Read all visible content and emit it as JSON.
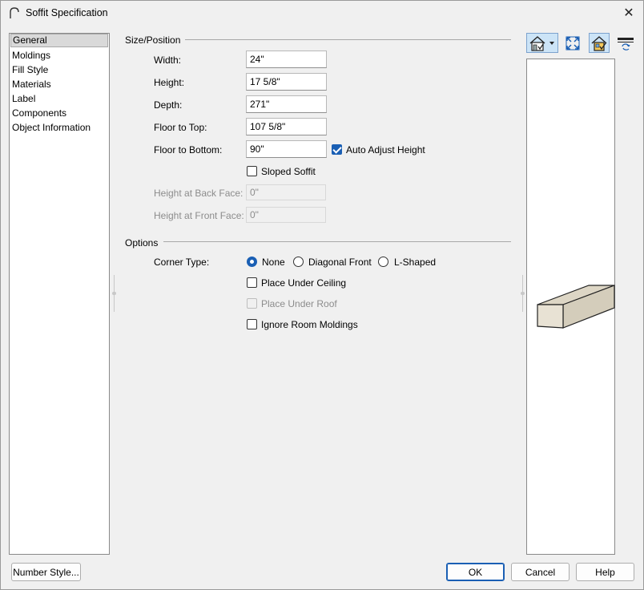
{
  "window": {
    "title": "Soffit Specification",
    "close_glyph": "✕"
  },
  "sidebar": {
    "items": [
      {
        "label": "General",
        "selected": true
      },
      {
        "label": "Moldings"
      },
      {
        "label": "Fill Style"
      },
      {
        "label": "Materials"
      },
      {
        "label": "Label"
      },
      {
        "label": "Components"
      },
      {
        "label": "Object Information"
      }
    ]
  },
  "size_position": {
    "heading": "Size/Position",
    "width": {
      "label": "Width:",
      "value": "24\""
    },
    "height": {
      "label": "Height:",
      "value": "17 5/8\""
    },
    "depth": {
      "label": "Depth:",
      "value": "271\""
    },
    "floor_to_top": {
      "label": "Floor to Top:",
      "value": "107 5/8\""
    },
    "floor_to_bottom": {
      "label": "Floor to Bottom:",
      "value": "90\""
    },
    "auto_adjust_height": {
      "label": "Auto Adjust Height",
      "checked": true
    },
    "sloped_soffit": {
      "label": "Sloped Soffit",
      "checked": false
    },
    "height_back_face": {
      "label": "Height at Back Face:",
      "value": "0\""
    },
    "height_front_face": {
      "label": "Height at Front Face:",
      "value": "0\""
    }
  },
  "options": {
    "heading": "Options",
    "corner_type_label": "Corner Type:",
    "corner_types": [
      {
        "label": "None",
        "selected": true
      },
      {
        "label": "Diagonal Front",
        "selected": false
      },
      {
        "label": "L-Shaped",
        "selected": false
      }
    ],
    "place_under_ceiling": {
      "label": "Place Under Ceiling",
      "checked": false
    },
    "place_under_roof": {
      "label": "Place Under Roof",
      "checked": false,
      "disabled": true
    },
    "ignore_room_moldings": {
      "label": "Ignore Room Moldings",
      "checked": false
    }
  },
  "toolbar": {
    "icons": [
      "view-angle-icon",
      "fit-view-icon",
      "color-house-icon",
      "render-style-icon"
    ]
  },
  "preview": {
    "shape": "soffit-box",
    "face_color": "#e8e2d4",
    "side_color": "#d4cdbb",
    "top_color": "#ddd6c5"
  },
  "buttons": {
    "number_style": "Number Style...",
    "ok": "OK",
    "cancel": "Cancel",
    "help": "Help"
  },
  "colors": {
    "accent": "#1a5fb4",
    "selected_bg": "#d9d9d9",
    "active_tool_bg": "#cce4f7"
  }
}
